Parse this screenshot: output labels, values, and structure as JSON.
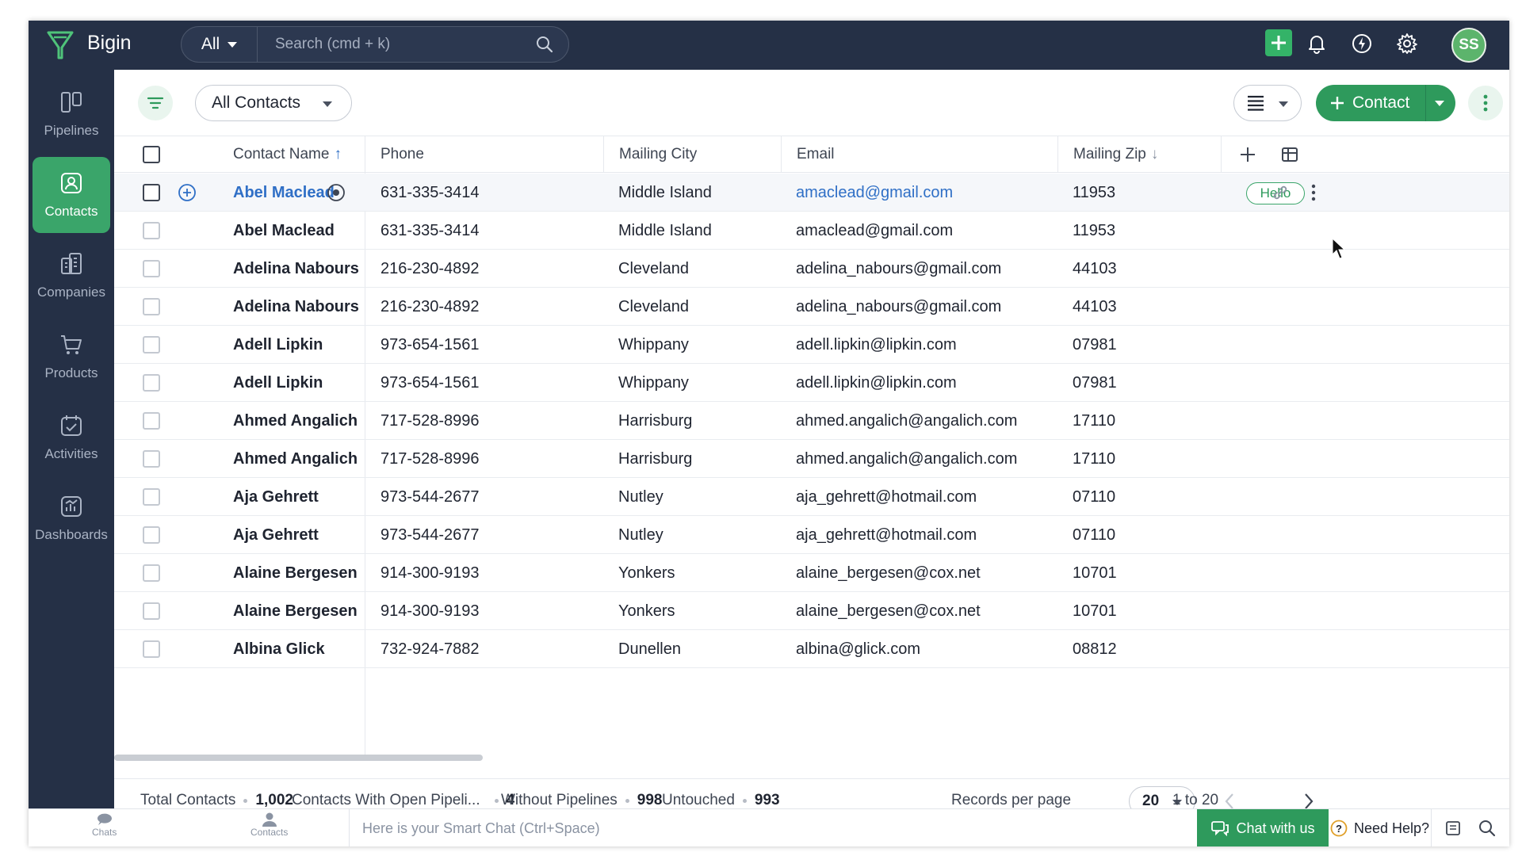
{
  "app": {
    "title": "Bigin"
  },
  "search": {
    "scope": "All",
    "placeholder": "Search (cmd + k)"
  },
  "user": {
    "initials": "SS"
  },
  "sidebar": {
    "items": [
      {
        "label": "Pipelines",
        "icon": "pipelines-icon",
        "active": false
      },
      {
        "label": "Contacts",
        "icon": "contacts-icon",
        "active": true
      },
      {
        "label": "Companies",
        "icon": "companies-icon",
        "active": false
      },
      {
        "label": "Products",
        "icon": "products-icon",
        "active": false
      },
      {
        "label": "Activities",
        "icon": "activities-icon",
        "active": false
      },
      {
        "label": "Dashboards",
        "icon": "dashboards-icon",
        "active": false
      }
    ]
  },
  "toolbar": {
    "view_name": "All Contacts",
    "add_label": "Contact"
  },
  "table": {
    "columns": [
      "Contact Name",
      "Phone",
      "Mailing City",
      "Email",
      "Mailing Zip"
    ],
    "sort_asc_indicator": "↑",
    "sort_desc_indicator": "↓",
    "hover_pill": "Hello",
    "rows": [
      {
        "name": "Abel Maclead",
        "phone": "631-335-3414",
        "city": "Middle Island",
        "email": "amaclead@gmail.com",
        "zip": "11953"
      },
      {
        "name": "Abel Maclead",
        "phone": "631-335-3414",
        "city": "Middle Island",
        "email": "amaclead@gmail.com",
        "zip": "11953"
      },
      {
        "name": "Adelina Nabours",
        "phone": "216-230-4892",
        "city": "Cleveland",
        "email": "adelina_nabours@gmail.com",
        "zip": "44103"
      },
      {
        "name": "Adelina Nabours",
        "phone": "216-230-4892",
        "city": "Cleveland",
        "email": "adelina_nabours@gmail.com",
        "zip": "44103"
      },
      {
        "name": "Adell Lipkin",
        "phone": "973-654-1561",
        "city": "Whippany",
        "email": "adell.lipkin@lipkin.com",
        "zip": "07981"
      },
      {
        "name": "Adell Lipkin",
        "phone": "973-654-1561",
        "city": "Whippany",
        "email": "adell.lipkin@lipkin.com",
        "zip": "07981"
      },
      {
        "name": "Ahmed Angalich",
        "phone": "717-528-8996",
        "city": "Harrisburg",
        "email": "ahmed.angalich@angalich.com",
        "zip": "17110"
      },
      {
        "name": "Ahmed Angalich",
        "phone": "717-528-8996",
        "city": "Harrisburg",
        "email": "ahmed.angalich@angalich.com",
        "zip": "17110"
      },
      {
        "name": "Aja Gehrett",
        "phone": "973-544-2677",
        "city": "Nutley",
        "email": "aja_gehrett@hotmail.com",
        "zip": "07110"
      },
      {
        "name": "Aja Gehrett",
        "phone": "973-544-2677",
        "city": "Nutley",
        "email": "aja_gehrett@hotmail.com",
        "zip": "07110"
      },
      {
        "name": "Alaine Bergesen",
        "phone": "914-300-9193",
        "city": "Yonkers",
        "email": "alaine_bergesen@cox.net",
        "zip": "10701"
      },
      {
        "name": "Alaine Bergesen",
        "phone": "914-300-9193",
        "city": "Yonkers",
        "email": "alaine_bergesen@cox.net",
        "zip": "10701"
      },
      {
        "name": "Albina Glick",
        "phone": "732-924-7882",
        "city": "Dunellen",
        "email": "albina@glick.com",
        "zip": "08812"
      }
    ]
  },
  "footer": {
    "total_label": "Total Contacts",
    "total_value": "1,002",
    "open_label": "Contacts With Open Pipeli...",
    "open_value": "4",
    "without_label": "Without Pipelines",
    "without_value": "998",
    "untouched_label": "Untouched",
    "untouched_value": "993",
    "per_page_label": "Records per page",
    "per_page_value": "20",
    "range": "1 to 20"
  },
  "bottom": {
    "chats_label": "Chats",
    "contacts_label": "Contacts",
    "smart_chat_placeholder": "Here is your Smart Chat (Ctrl+Space)",
    "chat_with_us": "Chat with us",
    "need_help": "Need Help?"
  },
  "colors": {
    "topbar": "#253046",
    "accent": "#2e9a5c",
    "link": "#2f6fc6"
  }
}
